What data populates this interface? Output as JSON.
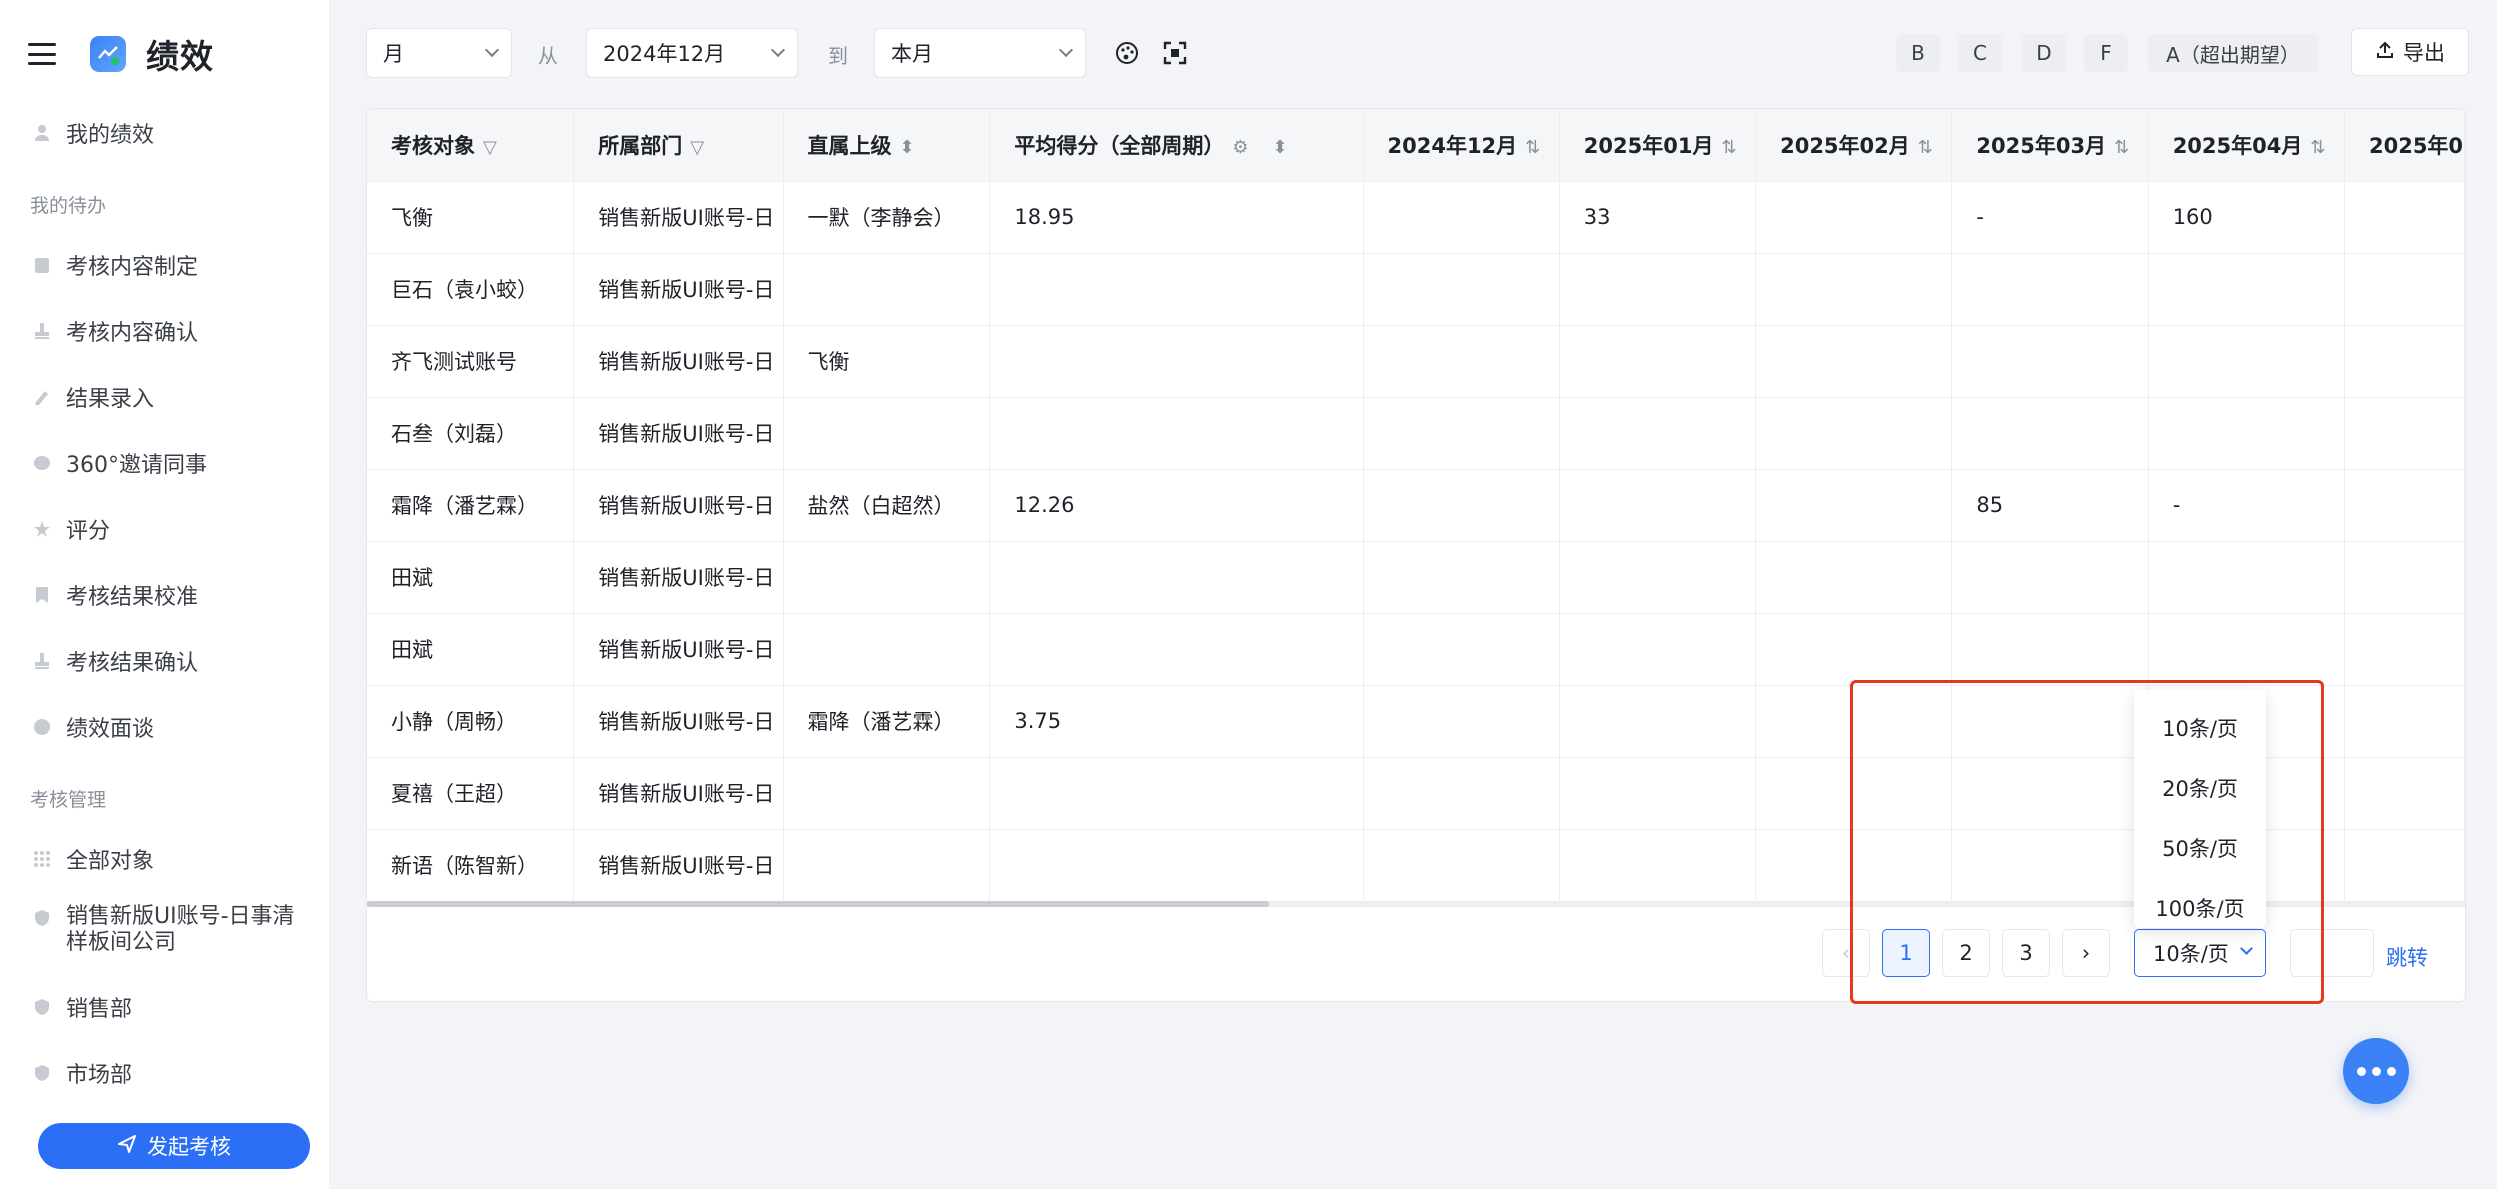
{
  "app": {
    "title": "绩效"
  },
  "sidebar": {
    "my_performance": "我的绩效",
    "todo_section": "我的待办",
    "todo_items": [
      "考核内容制定",
      "考核内容确认",
      "结果录入",
      "360°邀请同事",
      "评分",
      "考核结果校准",
      "考核结果确认",
      "绩效面谈"
    ],
    "manage_section": "考核管理",
    "manage_items": [
      "全部对象",
      "销售新版UI账号-日事清样板间公司",
      "销售部",
      "市场部"
    ],
    "launch_button": "发起考核"
  },
  "toolbar": {
    "period_type": "月",
    "from_label": "从",
    "from_value": "2024年12月",
    "to_label": "到",
    "to_value": "本月",
    "grades": [
      "B",
      "C",
      "D",
      "F",
      "A（超出期望）"
    ],
    "export_label": "导出"
  },
  "table": {
    "columns": [
      "考核对象",
      "所属部门",
      "直属上级",
      "平均得分（全部周期）",
      "2024年12月",
      "2025年01月",
      "2025年02月",
      "2025年03月",
      "2025年04月",
      "2025年0"
    ],
    "rows": [
      [
        "飞衡",
        "销售新版UI账号-日",
        "一默（李静会）",
        "18.95",
        "",
        "33",
        "",
        "-",
        "160",
        ""
      ],
      [
        "巨石（袁小蛟）",
        "销售新版UI账号-日",
        "",
        "",
        "",
        "",
        "",
        "",
        "",
        ""
      ],
      [
        "齐飞测试账号",
        "销售新版UI账号-日",
        "飞衡",
        "",
        "",
        "",
        "",
        "",
        "",
        ""
      ],
      [
        "石叁（刘磊）",
        "销售新版UI账号-日",
        "",
        "",
        "",
        "",
        "",
        "",
        "",
        ""
      ],
      [
        "霜降（潘艺霖）",
        "销售新版UI账号-日",
        "盐然（白超然）",
        "12.26",
        "",
        "",
        "",
        "85",
        "-",
        ""
      ],
      [
        "田斌",
        "销售新版UI账号-日",
        "",
        "",
        "",
        "",
        "",
        "",
        "",
        ""
      ],
      [
        "田斌",
        "销售新版UI账号-日",
        "",
        "",
        "",
        "",
        "",
        "",
        "",
        ""
      ],
      [
        "小静（周畅）",
        "销售新版UI账号-日",
        "霜降（潘艺霖）",
        "3.75",
        "",
        "",
        "",
        "",
        "",
        ""
      ],
      [
        "夏禧（王超）",
        "销售新版UI账号-日",
        "",
        "",
        "",
        "",
        "",
        "",
        "",
        ""
      ],
      [
        "新语（陈智新）",
        "销售新版UI账号-日",
        "",
        "",
        "",
        "",
        "",
        "",
        "",
        ""
      ]
    ]
  },
  "pagination": {
    "pages": [
      "1",
      "2",
      "3"
    ],
    "current_page": "1",
    "page_size": "10条/页",
    "page_size_options": [
      "10条/页",
      "20条/页",
      "50条/页",
      "100条/页"
    ],
    "jump_label": "跳转"
  },
  "colors": {
    "accent": "#2b6ff6",
    "highlight": "#e5391b"
  }
}
